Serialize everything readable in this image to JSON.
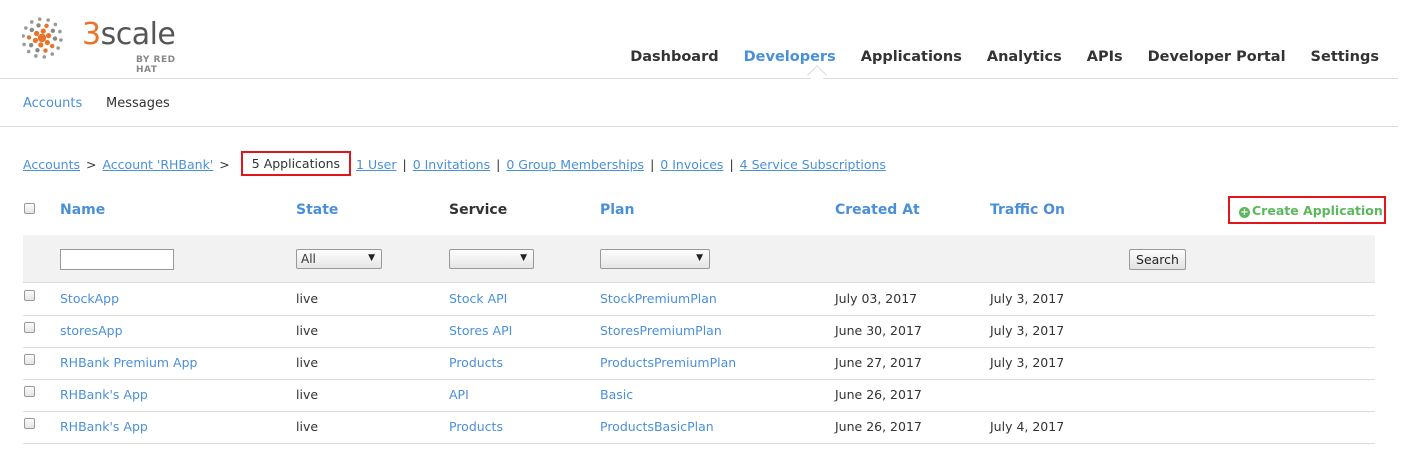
{
  "logo": {
    "brand_digit": "3",
    "brand_name": "scale",
    "sub": "BY RED HAT"
  },
  "nav": {
    "items": [
      "Dashboard",
      "Developers",
      "Applications",
      "Analytics",
      "APIs",
      "Developer Portal",
      "Settings"
    ],
    "active": "Developers"
  },
  "subnav": {
    "accounts": "Accounts",
    "messages": "Messages"
  },
  "breadcrumb": {
    "accounts": "Accounts",
    "sep": ">",
    "account": "Account 'RHBank'",
    "current": "5 Applications",
    "links": [
      "1 User",
      "0 Invitations",
      "0 Group Memberships",
      "0 Invoices",
      "4 Service Subscriptions"
    ],
    "pipe": "|"
  },
  "table": {
    "columns": {
      "name": "Name",
      "state": "State",
      "service": "Service",
      "plan": "Plan",
      "created_at": "Created At",
      "traffic_on": "Traffic On"
    },
    "create_label": "Create Application",
    "filters": {
      "name_value": "",
      "state_value": "All",
      "service_value": "",
      "plan_value": "",
      "search_label": "Search"
    },
    "rows": [
      {
        "name": "StockApp",
        "state": "live",
        "service": "Stock API",
        "plan": "StockPremiumPlan",
        "created_at": "July 03, 2017",
        "traffic_on": "July 3, 2017"
      },
      {
        "name": "storesApp",
        "state": "live",
        "service": "Stores API",
        "plan": "StoresPremiumPlan",
        "created_at": "June 30, 2017",
        "traffic_on": "July 3, 2017"
      },
      {
        "name": "RHBank Premium App",
        "state": "live",
        "service": "Products",
        "plan": "ProductsPremiumPlan",
        "created_at": "June 27, 2017",
        "traffic_on": "July 3, 2017"
      },
      {
        "name": "RHBank's App",
        "state": "live",
        "service": "API",
        "plan": "Basic",
        "created_at": "June 26, 2017",
        "traffic_on": ""
      },
      {
        "name": "RHBank's App",
        "state": "live",
        "service": "Products",
        "plan": "ProductsBasicPlan",
        "created_at": "June 26, 2017",
        "traffic_on": "July 4, 2017"
      }
    ]
  },
  "colors": {
    "link": "#4a90d9",
    "highlight": "#e0161b",
    "create": "#5cb85c",
    "brand": "#e8732a"
  },
  "icons": {
    "logo": "3scale-dots-logo",
    "create": "plus-circle-icon",
    "select": "caret-down-icon"
  }
}
